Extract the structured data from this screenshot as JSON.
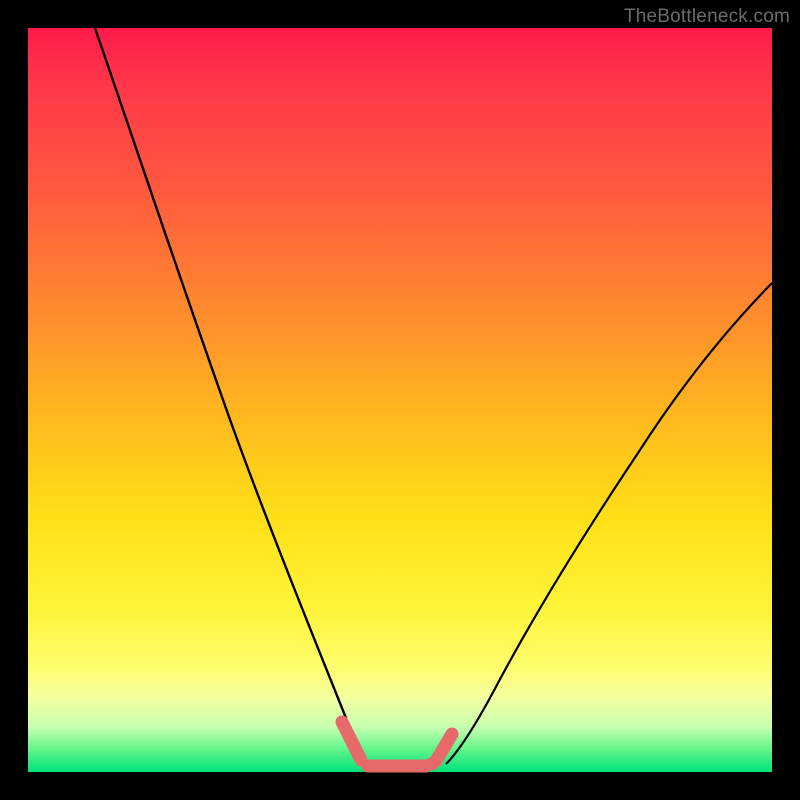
{
  "watermark": "TheBottleneck.com",
  "colors": {
    "frame": "#000000",
    "gradient_top": "#ff1a4a",
    "gradient_mid": "#ffe017",
    "gradient_bottom": "#00e27a",
    "curve": "#000000",
    "marker": "#e66a6a"
  },
  "chart_data": {
    "type": "line",
    "title": "",
    "xlabel": "",
    "ylabel": "",
    "xlim": [
      0,
      100
    ],
    "ylim": [
      0,
      100
    ],
    "series": [
      {
        "name": "left-curve",
        "x": [
          9,
          15,
          20,
          25,
          30,
          35,
          40,
          43,
          45
        ],
        "y": [
          100,
          82,
          67,
          52,
          37,
          23,
          11,
          4,
          1
        ]
      },
      {
        "name": "right-curve",
        "x": [
          55,
          60,
          65,
          70,
          75,
          80,
          85,
          90,
          95,
          100
        ],
        "y": [
          2,
          7,
          14,
          22,
          31,
          40,
          48,
          55,
          61,
          66
        ]
      },
      {
        "name": "bottom-markers",
        "x": [
          42,
          44,
          46,
          48,
          50,
          52,
          54,
          56
        ],
        "y": [
          2,
          1,
          0.5,
          0.5,
          0.5,
          0.5,
          1.5,
          3
        ]
      }
    ],
    "annotations": []
  }
}
